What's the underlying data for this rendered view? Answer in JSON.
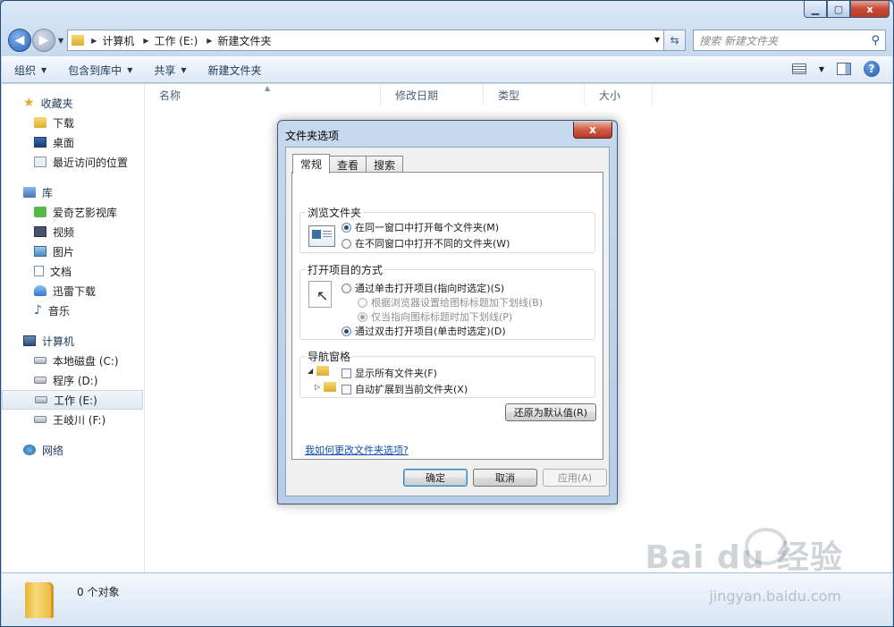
{
  "window": {
    "min_icon": "minimize-icon",
    "max_icon": "maximize-icon",
    "close_label": "x"
  },
  "nav": {
    "path": [
      "计算机",
      "工作 (E:)",
      "新建文件夹"
    ],
    "search_placeholder": "搜索 新建文件夹"
  },
  "toolbar": {
    "items": [
      "组织",
      "包含到库中",
      "共享",
      "新建文件夹"
    ]
  },
  "sidebar": {
    "favorites": {
      "label": "收藏夹",
      "items": [
        "下载",
        "桌面",
        "最近访问的位置"
      ]
    },
    "libraries": {
      "label": "库",
      "items": [
        "爱奇艺影视库",
        "视频",
        "图片",
        "文档",
        "迅雷下载",
        "音乐"
      ]
    },
    "computer": {
      "label": "计算机",
      "items": [
        "本地磁盘 (C:)",
        "程序 (D:)",
        "工作 (E:)",
        "王岐川 (F:)"
      ]
    },
    "network": {
      "label": "网络"
    }
  },
  "columns": [
    "名称",
    "修改日期",
    "类型",
    "大小"
  ],
  "status": {
    "text": "0 个对象"
  },
  "watermark": {
    "logo": "Bai du 经验",
    "url": "jingyan.baidu.com"
  },
  "dialog": {
    "title": "文件夹选项",
    "close_label": "x",
    "tabs": [
      "常规",
      "查看",
      "搜索"
    ],
    "browse_group": {
      "label": "浏览文件夹",
      "options": [
        "在同一窗口中打开每个文件夹(M)",
        "在不同窗口中打开不同的文件夹(W)"
      ],
      "selected": 0
    },
    "click_group": {
      "label": "打开项目的方式",
      "single": "通过单击打开项目(指向时选定)(S)",
      "sub1": "根据浏览器设置给图标标题加下划线(B)",
      "sub2": "仅当指向图标标题时加下划线(P)",
      "double": "通过双击打开项目(单击时选定)(D)"
    },
    "nav_group": {
      "label": "导航窗格",
      "options": [
        "显示所有文件夹(F)",
        "自动扩展到当前文件夹(X)"
      ]
    },
    "restore_button": "还原为默认值(R)",
    "help_link": "我如何更改文件夹选项?",
    "ok_button": "确定",
    "cancel_button": "取消",
    "apply_button": "应用(A)"
  }
}
